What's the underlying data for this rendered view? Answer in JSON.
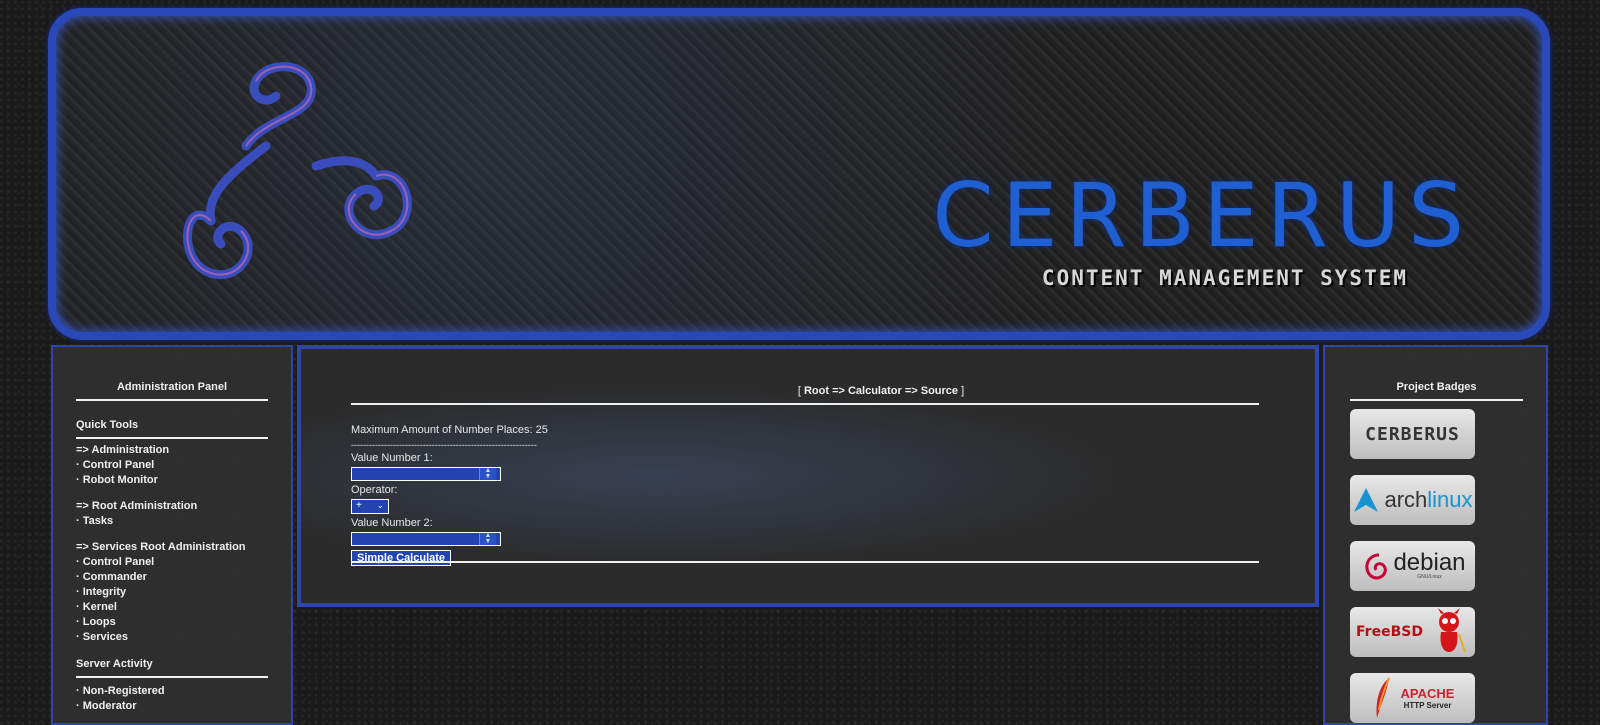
{
  "header": {
    "logo_title": "CERBERUS",
    "logo_subtitle": "CONTENT MANAGEMENT SYSTEM"
  },
  "left_panel": {
    "title": "Administration Panel",
    "sections": [
      {
        "title": "Quick Tools"
      },
      {
        "title": "Server Activity"
      }
    ],
    "groups": [
      {
        "heading": "=> Administration",
        "items": [
          "Control Panel",
          "Robot Monitor"
        ]
      },
      {
        "heading": "=> Root Administration",
        "items": [
          "Tasks"
        ]
      },
      {
        "heading": "=> Services Root Administration",
        "items": [
          "Control Panel",
          "Commander",
          "Integrity",
          "Kernel",
          "Loops",
          "Services"
        ]
      }
    ],
    "server_activity_items": [
      "Non-Registered",
      "Moderator"
    ],
    "bullet": "·"
  },
  "center_panel": {
    "breadcrumb": {
      "open": "[",
      "path": "Root => Calculator => Source",
      "close": "]"
    },
    "max_places_label": "Maximum Amount of Number Places: 25",
    "separator": "--------------------------------------------------------------",
    "value1_label": "Value Number 1:",
    "value1": "",
    "operator_label": "Operator:",
    "operator_value": "+",
    "value2_label": "Value Number 2:",
    "value2": "",
    "button_label": "Simple Calculate"
  },
  "right_panel": {
    "title": "Project Badges",
    "badges": [
      {
        "name": "CERBERUS"
      },
      {
        "name": "archlinux",
        "prefix": "arch",
        "suffix": "linux"
      },
      {
        "name": "debian",
        "small": "GNU/Linux"
      },
      {
        "name": "FreeBSD"
      },
      {
        "name": "APACHE",
        "small": "HTTP Server"
      }
    ]
  },
  "colors": {
    "accent_blue": "#2d46a8",
    "input_blue": "#2344b0",
    "logo_blue": "#1f5fd2"
  }
}
